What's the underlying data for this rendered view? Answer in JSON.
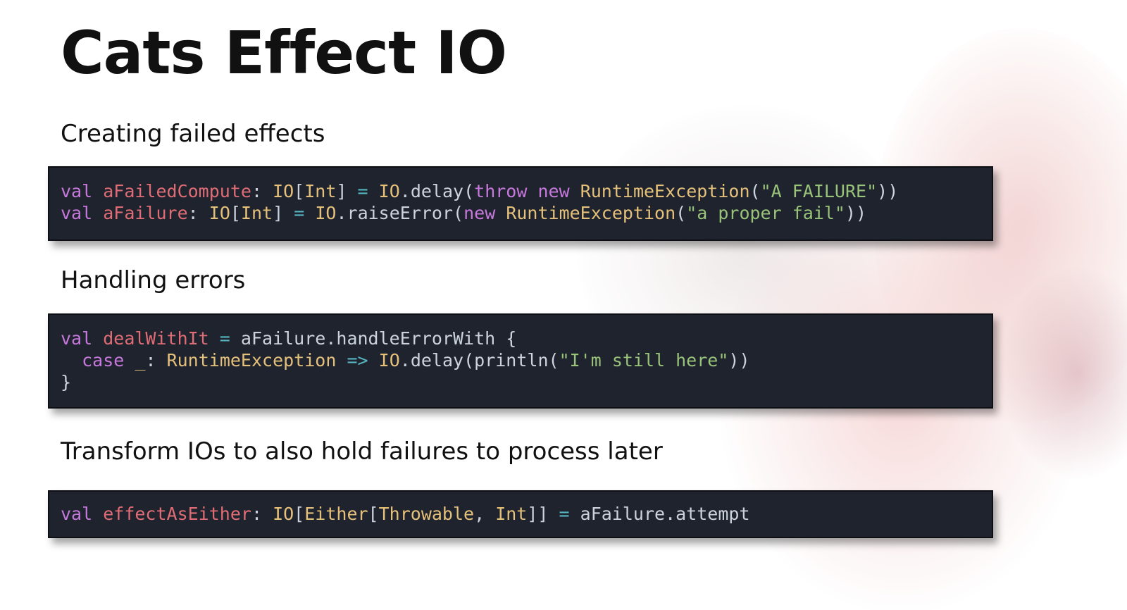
{
  "slide": {
    "title": "Cats Effect IO",
    "sections": [
      {
        "heading": "Creating failed effects",
        "code": [
          "val aFailedCompute: IO[Int] = IO.delay(throw new RuntimeException(\"A FAILURE\"))",
          "val aFailure: IO[Int] = IO.raiseError(new RuntimeException(\"a proper fail\"))"
        ]
      },
      {
        "heading": "Handling errors",
        "code": [
          "val dealWithIt = aFailure.handleErrorWith {",
          "  case _: RuntimeException => IO.delay(println(\"I'm still here\"))",
          "}"
        ]
      },
      {
        "heading": "Transform IOs to also hold failures to process later",
        "code": [
          "val effectAsEither: IO[Either[Throwable, Int]] = aFailure.attempt"
        ]
      }
    ]
  },
  "theme": {
    "code_background": "#1f232d",
    "keyword": "#c678dd",
    "identifier": "#e06c75",
    "type": "#e5c07b",
    "operator": "#56b6c2",
    "string": "#98c379",
    "plain": "#cdd3de"
  }
}
